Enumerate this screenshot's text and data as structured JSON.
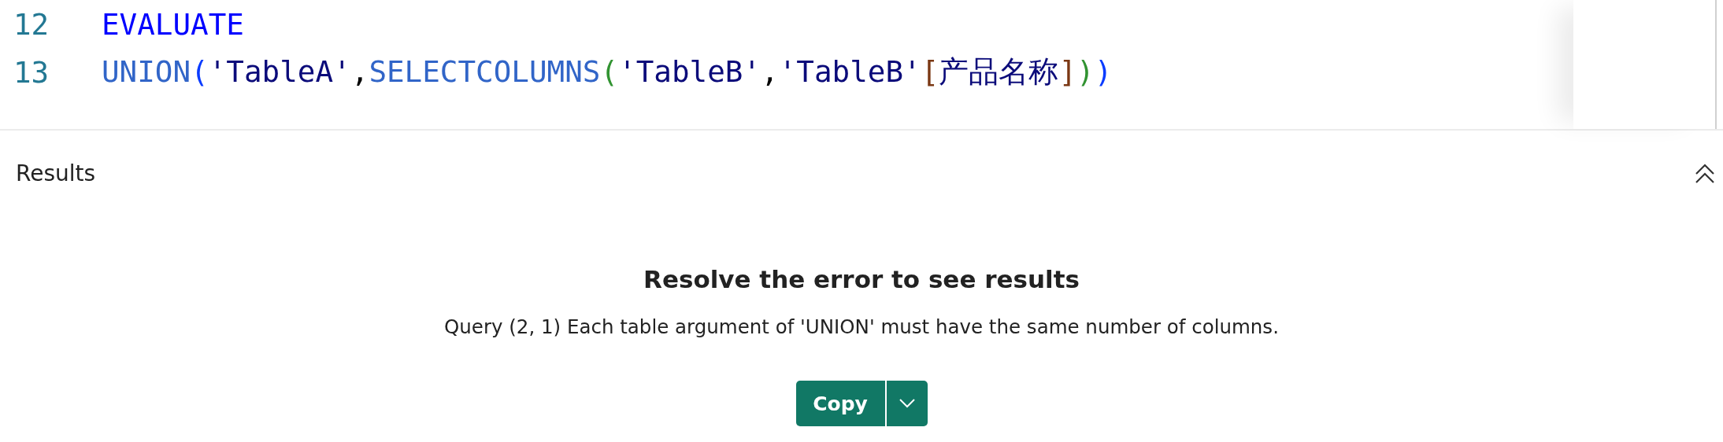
{
  "editor": {
    "lines": [
      {
        "number": "12",
        "tokens": [
          {
            "kind": "keyword",
            "text": "EVALUATE"
          }
        ]
      },
      {
        "number": "13",
        "tokens": [
          {
            "kind": "function",
            "text": "UNION"
          },
          {
            "kind": "paren1",
            "text": "("
          },
          {
            "kind": "string",
            "text": "'TableA'"
          },
          {
            "kind": "punct",
            "text": ","
          },
          {
            "kind": "function",
            "text": "SELECTCOLUMNS"
          },
          {
            "kind": "paren2",
            "text": "("
          },
          {
            "kind": "string",
            "text": "'TableB'"
          },
          {
            "kind": "punct",
            "text": ","
          },
          {
            "kind": "string",
            "text": "'TableB'"
          },
          {
            "kind": "bracket",
            "text": "["
          },
          {
            "kind": "string",
            "text": "产品名称"
          },
          {
            "kind": "bracket",
            "text": "]"
          },
          {
            "kind": "paren2",
            "text": ")"
          },
          {
            "kind": "paren1",
            "text": ")"
          }
        ]
      }
    ]
  },
  "results": {
    "title": "Results",
    "expanded": true,
    "error_title": "Resolve the error to see results",
    "error_message": "Query (2, 1) Each table argument of 'UNION' must have the same number of columns.",
    "copy_button": "Copy"
  }
}
